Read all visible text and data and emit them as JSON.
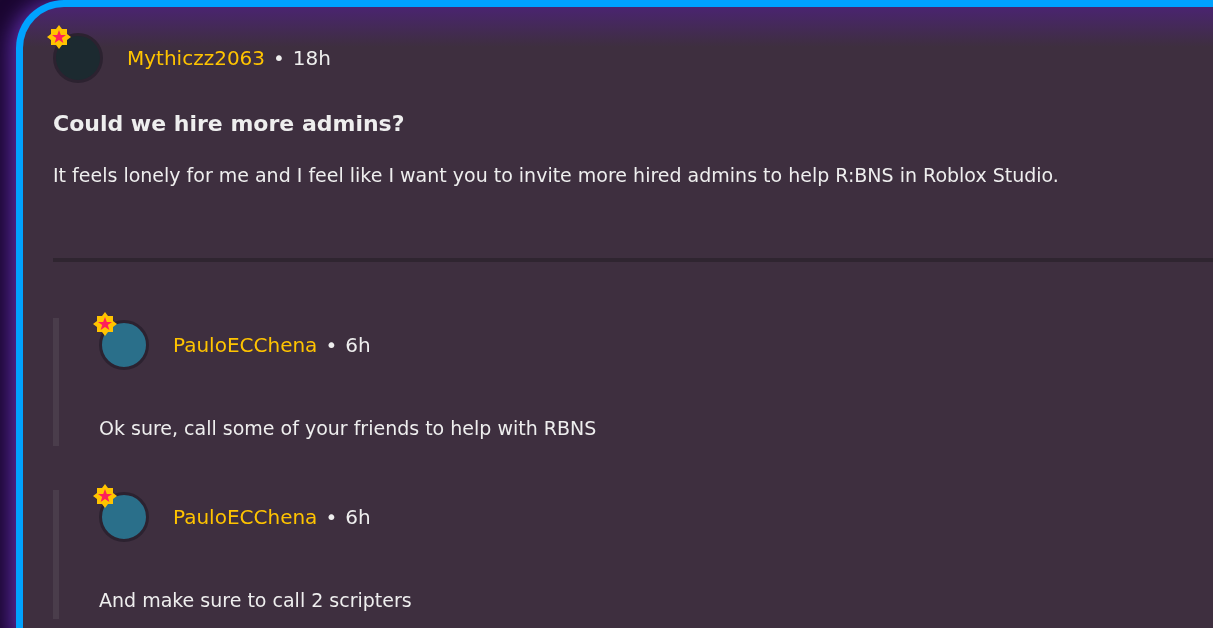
{
  "post": {
    "author": "Mythiczz2063",
    "separator": "•",
    "time": "18h",
    "title": "Could we hire more admins?",
    "body": "It feels lonely for me and I feel like I want you to invite more hired admins to help R:BNS in Roblox Studio."
  },
  "replies": [
    {
      "author": "PauloECChena",
      "separator": "•",
      "time": "6h",
      "body": "Ok sure, call some of your friends to help with RBNS"
    },
    {
      "author": "PauloECChena",
      "separator": "•",
      "time": "6h",
      "body": "And make sure to call 2 scripters"
    }
  ]
}
